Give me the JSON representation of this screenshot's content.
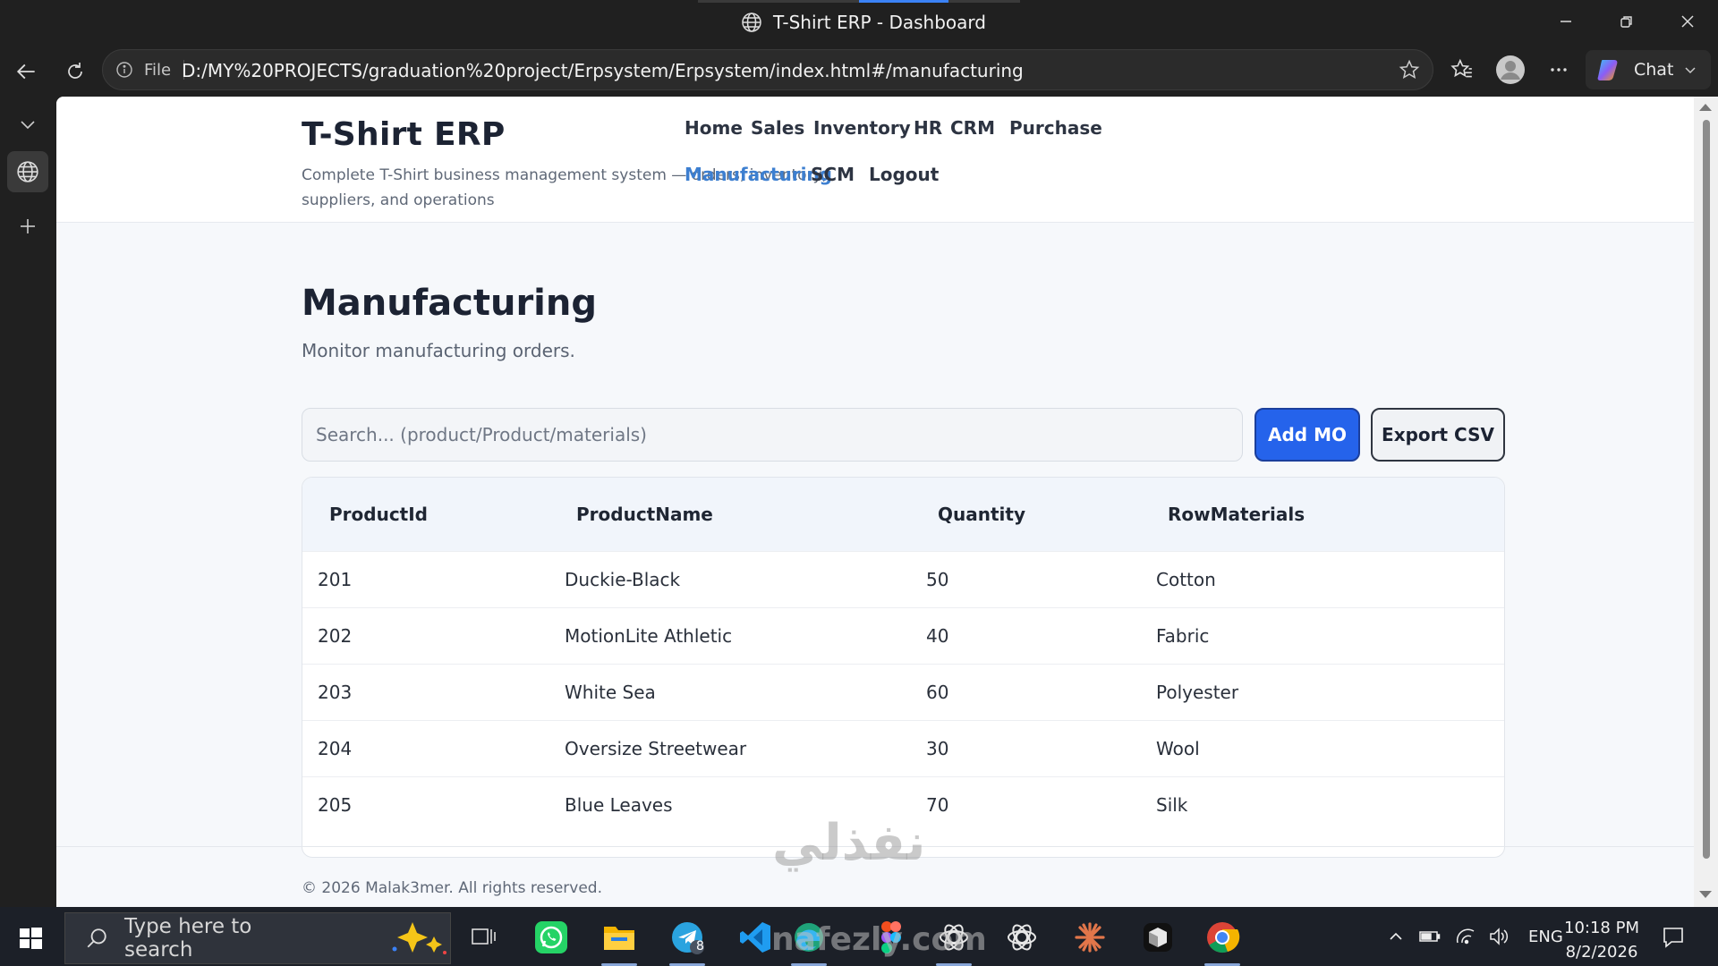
{
  "window": {
    "title": "T-Shirt ERP - Dashboard"
  },
  "browser": {
    "url_label": "File",
    "url": "D:/MY%20PROJECTS/graduation%20project/Erpsystem/Erpsystem/index.html#/manufacturing",
    "chat_label": "Chat"
  },
  "site": {
    "brand": "T-Shirt ERP",
    "tagline": "Complete T-Shirt business management system — orders, inventory, suppliers, and operations",
    "nav": [
      "Home",
      "Sales",
      "Inventory",
      "HR",
      "CRM",
      "Purchase",
      "Manufacturing",
      "SCM",
      "Logout"
    ],
    "active_nav": "Manufacturing"
  },
  "page": {
    "title": "Manufacturing",
    "subtitle": "Monitor manufacturing orders.",
    "search_placeholder": "Search... (product/Product/materials)",
    "add_button": "Add MO",
    "export_button": "Export CSV"
  },
  "table": {
    "columns": [
      "ProductId",
      "ProductName",
      "Quantity",
      "RowMaterials"
    ],
    "rows": [
      [
        "201",
        "Duckie-Black",
        "50",
        "Cotton"
      ],
      [
        "202",
        "MotionLite Athletic",
        "40",
        "Fabric"
      ],
      [
        "203",
        "White Sea",
        "60",
        "Polyester"
      ],
      [
        "204",
        "Oversize Streetwear",
        "30",
        "Wool"
      ],
      [
        "205",
        "Blue Leaves",
        "70",
        "Silk"
      ]
    ]
  },
  "footer": {
    "text": "© 2026 Malak3mer. All rights reserved."
  },
  "watermark": {
    "arabic": "نفذلي",
    "latin": "nafezly.com"
  },
  "taskbar": {
    "search_placeholder": "Type here to search",
    "telegram_badge": "8",
    "language": "ENG",
    "time": "10:18 PM",
    "date": "8/2/2026"
  },
  "colors": {
    "accent": "#2563eb",
    "nav_active": "#3d7fd0"
  }
}
